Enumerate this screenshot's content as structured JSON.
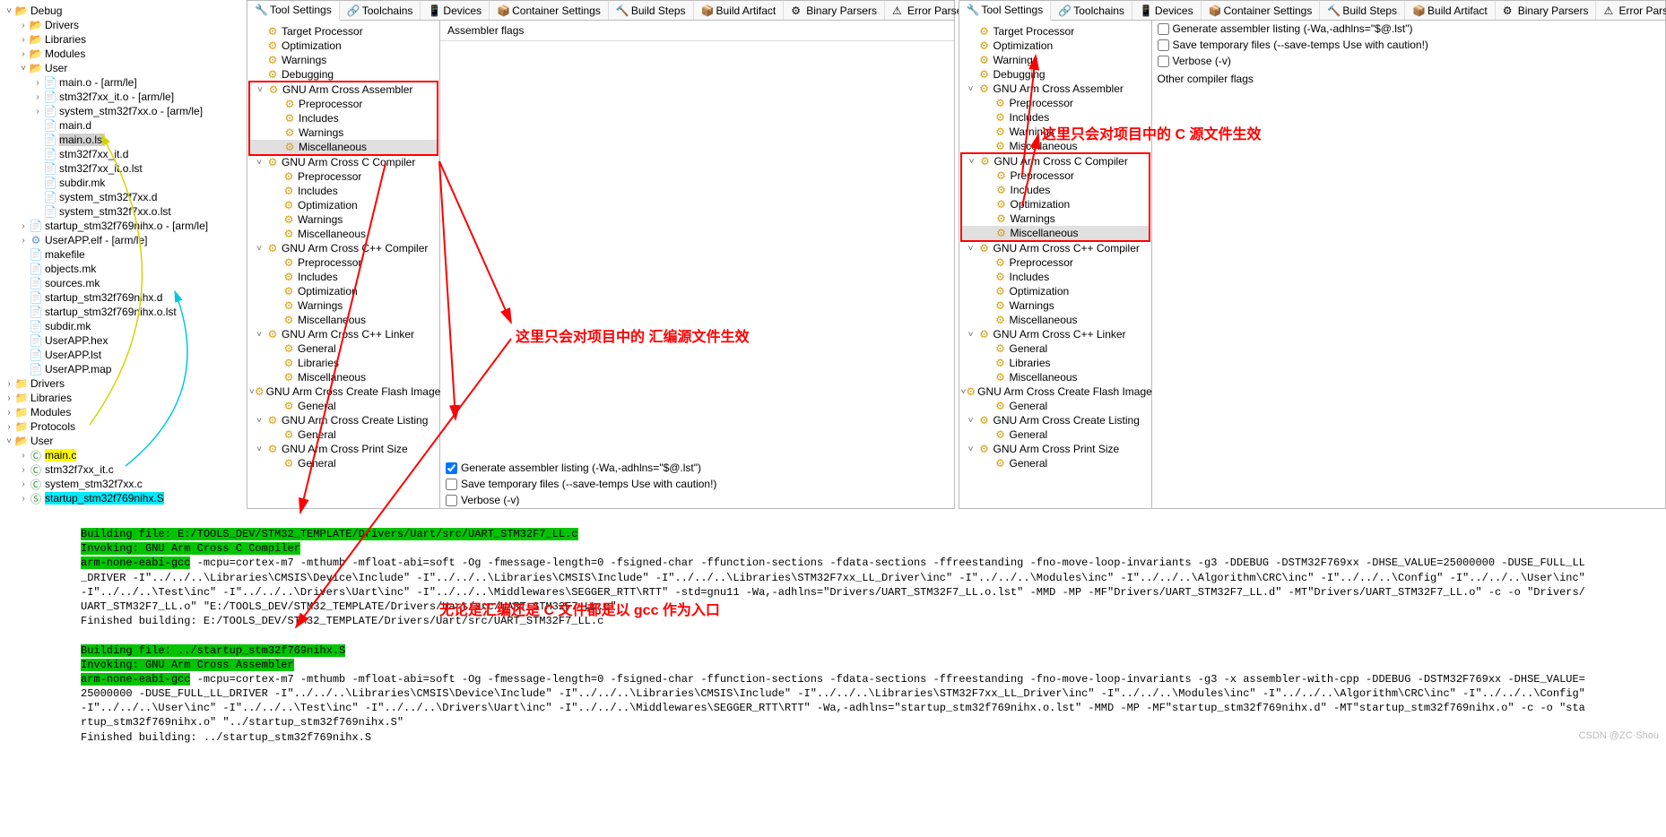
{
  "left_tree": {
    "items": [
      {
        "d": 0,
        "e": "v",
        "i": "📂",
        "t": "Debug"
      },
      {
        "d": 1,
        "e": ">",
        "i": "📂",
        "t": "Drivers"
      },
      {
        "d": 1,
        "e": ">",
        "i": "📂",
        "t": "Libraries"
      },
      {
        "d": 1,
        "e": ">",
        "i": "📂",
        "t": "Modules"
      },
      {
        "d": 1,
        "e": "v",
        "i": "📂",
        "t": "User"
      },
      {
        "d": 2,
        "e": ">",
        "i": "📄",
        "t": "main.o - [arm/le]"
      },
      {
        "d": 2,
        "e": ">",
        "i": "📄",
        "t": "stm32f7xx_it.o - [arm/le]"
      },
      {
        "d": 2,
        "e": ">",
        "i": "📄",
        "t": "system_stm32f7xx.o - [arm/le]"
      },
      {
        "d": 2,
        "e": " ",
        "i": "📄",
        "t": "main.d"
      },
      {
        "d": 2,
        "e": " ",
        "i": "📄",
        "t": "main.o.lst",
        "hl": "gray"
      },
      {
        "d": 2,
        "e": " ",
        "i": "📄",
        "t": "stm32f7xx_it.d"
      },
      {
        "d": 2,
        "e": " ",
        "i": "📄",
        "t": "stm32f7xx_it.o.lst"
      },
      {
        "d": 2,
        "e": " ",
        "i": "📄",
        "t": "subdir.mk"
      },
      {
        "d": 2,
        "e": " ",
        "i": "📄",
        "t": "system_stm32f7xx.d"
      },
      {
        "d": 2,
        "e": " ",
        "i": "📄",
        "t": "system_stm32f7xx.o.lst"
      },
      {
        "d": 1,
        "e": ">",
        "i": "📄",
        "t": "startup_stm32f769nihx.o - [arm/le]"
      },
      {
        "d": 1,
        "e": ">",
        "i": "⚙",
        "t": "UserAPP.elf - [arm/le]"
      },
      {
        "d": 1,
        "e": " ",
        "i": "📄",
        "t": "makefile"
      },
      {
        "d": 1,
        "e": " ",
        "i": "📄",
        "t": "objects.mk"
      },
      {
        "d": 1,
        "e": " ",
        "i": "📄",
        "t": "sources.mk"
      },
      {
        "d": 1,
        "e": " ",
        "i": "📄",
        "t": "startup_stm32f769nihx.d"
      },
      {
        "d": 1,
        "e": " ",
        "i": "📄",
        "t": "startup_stm32f769nihx.o.lst"
      },
      {
        "d": 1,
        "e": " ",
        "i": "📄",
        "t": "subdir.mk"
      },
      {
        "d": 1,
        "e": " ",
        "i": "📄",
        "t": "UserAPP.hex"
      },
      {
        "d": 1,
        "e": " ",
        "i": "📄",
        "t": "UserAPP.lst"
      },
      {
        "d": 1,
        "e": " ",
        "i": "📄",
        "t": "UserAPP.map"
      },
      {
        "d": 0,
        "e": ">",
        "i": "📁",
        "t": "Drivers"
      },
      {
        "d": 0,
        "e": ">",
        "i": "📁",
        "t": "Libraries"
      },
      {
        "d": 0,
        "e": ">",
        "i": "📁",
        "t": "Modules"
      },
      {
        "d": 0,
        "e": ">",
        "i": "📁",
        "t": "Protocols"
      },
      {
        "d": 0,
        "e": "v",
        "i": "📂",
        "t": "User"
      },
      {
        "d": 1,
        "e": ">",
        "i": "c",
        "t": "main.c",
        "hl": "yellow"
      },
      {
        "d": 1,
        "e": ">",
        "i": "c",
        "t": "stm32f7xx_it.c"
      },
      {
        "d": 1,
        "e": ">",
        "i": "c",
        "t": "system_stm32f7xx.c"
      },
      {
        "d": 1,
        "e": ">",
        "i": "S",
        "t": "startup_stm32f769nihx.S",
        "hl": "cyan"
      }
    ]
  },
  "tabs": [
    {
      "icon": "🔧",
      "label": "Tool Settings"
    },
    {
      "icon": "🔗",
      "label": "Toolchains"
    },
    {
      "icon": "📱",
      "label": "Devices"
    },
    {
      "icon": "📦",
      "label": "Container Settings"
    },
    {
      "icon": "🔨",
      "label": "Build Steps"
    },
    {
      "icon": "📦",
      "label": "Build Artifact"
    },
    {
      "icon": "⚙",
      "label": "Binary Parsers"
    },
    {
      "icon": "⚠",
      "label": "Error Parsers"
    }
  ],
  "settings_tree": [
    {
      "d": 0,
      "e": " ",
      "i": "⚙",
      "t": "Target Processor"
    },
    {
      "d": 0,
      "e": " ",
      "i": "⚙",
      "t": "Optimization"
    },
    {
      "d": 0,
      "e": " ",
      "i": "⚙",
      "t": "Warnings"
    },
    {
      "d": 0,
      "e": " ",
      "i": "⚙",
      "t": "Debugging"
    },
    {
      "d": 0,
      "e": "v",
      "i": "⚙",
      "t": "GNU Arm Cross Assembler"
    },
    {
      "d": 1,
      "e": " ",
      "i": "⚙",
      "t": "Preprocessor"
    },
    {
      "d": 1,
      "e": " ",
      "i": "⚙",
      "t": "Includes"
    },
    {
      "d": 1,
      "e": " ",
      "i": "⚙",
      "t": "Warnings"
    },
    {
      "d": 1,
      "e": " ",
      "i": "⚙",
      "t": "Miscellaneous"
    },
    {
      "d": 0,
      "e": "v",
      "i": "⚙",
      "t": "GNU Arm Cross C Compiler"
    },
    {
      "d": 1,
      "e": " ",
      "i": "⚙",
      "t": "Preprocessor"
    },
    {
      "d": 1,
      "e": " ",
      "i": "⚙",
      "t": "Includes"
    },
    {
      "d": 1,
      "e": " ",
      "i": "⚙",
      "t": "Optimization"
    },
    {
      "d": 1,
      "e": " ",
      "i": "⚙",
      "t": "Warnings"
    },
    {
      "d": 1,
      "e": " ",
      "i": "⚙",
      "t": "Miscellaneous"
    },
    {
      "d": 0,
      "e": "v",
      "i": "⚙",
      "t": "GNU Arm Cross C++ Compiler"
    },
    {
      "d": 1,
      "e": " ",
      "i": "⚙",
      "t": "Preprocessor"
    },
    {
      "d": 1,
      "e": " ",
      "i": "⚙",
      "t": "Includes"
    },
    {
      "d": 1,
      "e": " ",
      "i": "⚙",
      "t": "Optimization"
    },
    {
      "d": 1,
      "e": " ",
      "i": "⚙",
      "t": "Warnings"
    },
    {
      "d": 1,
      "e": " ",
      "i": "⚙",
      "t": "Miscellaneous"
    },
    {
      "d": 0,
      "e": "v",
      "i": "⚙",
      "t": "GNU Arm Cross C++ Linker"
    },
    {
      "d": 1,
      "e": " ",
      "i": "⚙",
      "t": "General"
    },
    {
      "d": 1,
      "e": " ",
      "i": "⚙",
      "t": "Libraries"
    },
    {
      "d": 1,
      "e": " ",
      "i": "⚙",
      "t": "Miscellaneous"
    },
    {
      "d": 0,
      "e": "v",
      "i": "⚙",
      "t": "GNU Arm Cross Create Flash Image"
    },
    {
      "d": 1,
      "e": " ",
      "i": "⚙",
      "t": "General"
    },
    {
      "d": 0,
      "e": "v",
      "i": "⚙",
      "t": "GNU Arm Cross Create Listing"
    },
    {
      "d": 1,
      "e": " ",
      "i": "⚙",
      "t": "General"
    },
    {
      "d": 0,
      "e": "v",
      "i": "⚙",
      "t": "GNU Arm Cross Print Size"
    },
    {
      "d": 1,
      "e": " ",
      "i": "⚙",
      "t": "General"
    }
  ],
  "panelA": {
    "header": "Assembler flags",
    "sel_index": 8,
    "redbox_start": 4,
    "redbox_end": 8,
    "checks": [
      {
        "checked": true,
        "label": "Generate assembler listing (-Wa,-adhlns=\"$@.lst\")"
      },
      {
        "checked": false,
        "label": "Save temporary files (--save-temps Use with caution!)"
      },
      {
        "checked": false,
        "label": "Verbose (-v)"
      }
    ]
  },
  "panelB": {
    "sel_index": 14,
    "redbox_start": 9,
    "redbox_end": 14,
    "checks": [
      {
        "checked": false,
        "label": "Generate assembler listing (-Wa,-adhlns=\"$@.lst\")"
      },
      {
        "checked": false,
        "label": "Save temporary files (--save-temps Use with caution!)"
      },
      {
        "checked": false,
        "label": "Verbose (-v)"
      }
    ],
    "other_flags_label": "Other compiler flags"
  },
  "annot": {
    "asm": "这里只会对项目中的 汇编源文件生效",
    "c": "这里只会对项目中的 C 源文件生效",
    "gcc": "无论是汇编还是 C 文件都是以 gcc 作为入口"
  },
  "console": {
    "lines": [
      {
        "cls": "green-bg",
        "t": "Building file: E:/TOOLS_DEV/STM32_TEMPLATE/Drivers/Uart/src/UART_STM32F7_LL.c"
      },
      {
        "cls": "green-bg",
        "t": "Invoking: GNU Arm Cross C Compiler"
      },
      {
        "cls": "",
        "pre": "arm-none-eabi-gcc",
        "t": " -mcpu=cortex-m7 -mthumb -mfloat-abi=soft -Og -fmessage-length=0 -fsigned-char -ffunction-sections -fdata-sections -ffreestanding -fno-move-loop-invariants -g3 -DDEBUG -DSTM32F769xx -DHSE_VALUE=25000000 -DUSE_FULL_LL_DRIVER -I\"../../..\\Libraries\\CMSIS\\Device\\Include\" -I\"../../..\\Libraries\\CMSIS\\Include\" -I\"../../..\\Libraries\\STM32F7xx_LL_Driver\\inc\" -I\"../../..\\Modules\\inc\" -I\"../../..\\Algorithm\\CRC\\inc\" -I\"../../..\\Config\" -I\"../../..\\User\\inc\" -I\"../../..\\Test\\inc\" -I\"../../..\\Drivers\\Uart\\inc\" -I\"../../..\\Middlewares\\SEGGER_RTT\\RTT\" -std=gnu11 -Wa,-adhlns=\"Drivers/UART_STM32F7_LL.o.lst\" -MMD -MP -MF\"Drivers/UART_STM32F7_LL.d\" -MT\"Drivers/UART_STM32F7_LL.o\" -c -o \"Drivers/UART_STM32F7_LL.o\" \"E:/TOOLS_DEV/STM32_TEMPLATE/Drivers/Uart/src/UART_STM32F7_LL.c\""
      },
      {
        "cls": "",
        "t": "Finished building: E:/TOOLS_DEV/STM32_TEMPLATE/Drivers/Uart/src/UART_STM32F7_LL.c"
      },
      {
        "cls": "",
        "t": " "
      },
      {
        "cls": "green-bg",
        "t": "Building file: ../startup_stm32f769nihx.S"
      },
      {
        "cls": "green-bg",
        "t": "Invoking: GNU Arm Cross Assembler"
      },
      {
        "cls": "",
        "pre": "arm-none-eabi-gcc",
        "t": " -mcpu=cortex-m7 -mthumb -mfloat-abi=soft -Og -fmessage-length=0 -fsigned-char -ffunction-sections -fdata-sections -ffreestanding -fno-move-loop-invariants -g3 -x assembler-with-cpp -DDEBUG -DSTM32F769xx -DHSE_VALUE=25000000 -DUSE_FULL_LL_DRIVER -I\"../../..\\Libraries\\CMSIS\\Device\\Include\" -I\"../../..\\Libraries\\CMSIS\\Include\" -I\"../../..\\Libraries\\STM32F7xx_LL_Driver\\inc\" -I\"../../..\\Modules\\inc\" -I\"../../..\\Algorithm\\CRC\\inc\" -I\"../../..\\Config\" -I\"../../..\\User\\inc\" -I\"../../..\\Test\\inc\" -I\"../../..\\Drivers\\Uart\\inc\" -I\"../../..\\Middlewares\\SEGGER_RTT\\RTT\" -Wa,-adhlns=\"startup_stm32f769nihx.o.lst\" -MMD -MP -MF\"startup_stm32f769nihx.d\" -MT\"startup_stm32f769nihx.o\" -c -o \"startup_stm32f769nihx.o\" \"../startup_stm32f769nihx.S\""
      },
      {
        "cls": "",
        "t": "Finished building: ../startup_stm32f769nihx.S"
      }
    ]
  },
  "footer": "CSDN @ZC·Shou"
}
